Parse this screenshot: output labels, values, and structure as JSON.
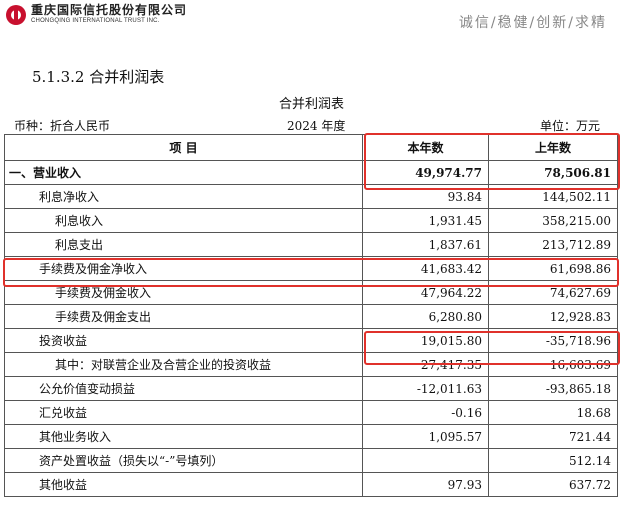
{
  "header": {
    "logo_cn": "重庆国际信托股份有限公司",
    "logo_en": "CHONGQING INTERNATIONAL TRUST INC.",
    "slogan": "诚信/稳健/创新/求精"
  },
  "section_title": "5.1.3.2 合并利润表",
  "table_title": "合并利润表",
  "currency": "币种：折合人民币",
  "period": "2024 年度",
  "unit": "单位：万元",
  "columns": [
    "项 目",
    "本年数",
    "上年数"
  ],
  "rows": [
    {
      "label": "一、营业收入",
      "current": "49,974.77",
      "prior": "78,506.81"
    },
    {
      "label": "利息净收入",
      "current": "93.84",
      "prior": "144,502.11"
    },
    {
      "label": "利息收入",
      "current": "1,931.45",
      "prior": "358,215.00"
    },
    {
      "label": "利息支出",
      "current": "1,837.61",
      "prior": "213,712.89"
    },
    {
      "label": "手续费及佣金净收入",
      "current": "41,683.42",
      "prior": "61,698.86"
    },
    {
      "label": "手续费及佣金收入",
      "current": "47,964.22",
      "prior": "74,627.69"
    },
    {
      "label": "手续费及佣金支出",
      "current": "6,280.80",
      "prior": "12,928.83"
    },
    {
      "label": "投资收益",
      "current": "19,015.80",
      "prior": "-35,718.96"
    },
    {
      "label": "其中：对联营企业及合营企业的投资收益",
      "current": "27,417.35",
      "prior": "16,603.69"
    },
    {
      "label": "公允价值变动损益",
      "current": "-12,011.63",
      "prior": "-93,865.18"
    },
    {
      "label": "汇兑收益",
      "current": "-0.16",
      "prior": "18.68"
    },
    {
      "label": "其他业务收入",
      "current": "1,095.57",
      "prior": "721.44"
    },
    {
      "label": "资产处置收益（损失以“-”号填列）",
      "current": "",
      "prior": "512.14"
    },
    {
      "label": "其他收益",
      "current": "97.93",
      "prior": "637.72"
    }
  ],
  "colors": {
    "highlight": "#e0312b",
    "logo": "#c8102e"
  }
}
